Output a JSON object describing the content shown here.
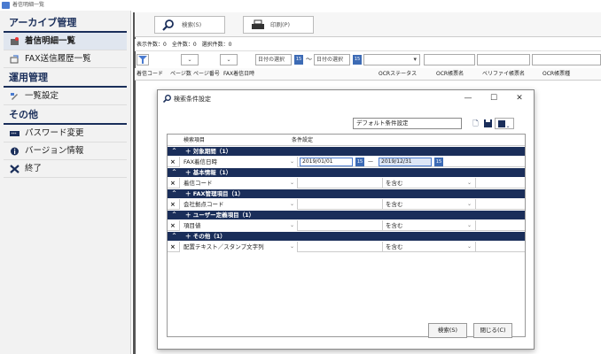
{
  "window": {
    "title": "着信明細一覧"
  },
  "sidebar": {
    "sections": [
      {
        "heading": "アーカイブ管理",
        "items": [
          {
            "label": "着信明細一覧",
            "icon": "fax-inbox-icon",
            "active": true
          },
          {
            "label": "FAX送信履歴一覧",
            "icon": "fax-sent-icon",
            "active": false
          }
        ]
      },
      {
        "heading": "運用管理",
        "items": [
          {
            "label": "一覧設定",
            "icon": "list-settings-icon",
            "active": false
          }
        ]
      },
      {
        "heading": "その他",
        "items": [
          {
            "label": "パスワード変更",
            "icon": "password-icon",
            "active": false
          },
          {
            "label": "バージョン情報",
            "icon": "info-icon",
            "active": false
          },
          {
            "label": "終了",
            "icon": "exit-icon",
            "active": false
          }
        ]
      }
    ]
  },
  "toolbar": {
    "search_label": "検索(S)",
    "print_label": "印刷(P)"
  },
  "counts": {
    "text": "表示件数：0　全件数：0　選択件数：0"
  },
  "filter": {
    "date_select_1": "日付の選択",
    "date_select_2": "日付の選択",
    "tilde": "～",
    "cal_label": "15"
  },
  "columns": [
    "着信コード",
    "ページ数",
    "ページ番号",
    "FAX着信日時",
    "OCRステータス",
    "OCR帳票名",
    "ベリファイ帳票名",
    "OCR帳票種"
  ],
  "dialog": {
    "title": "検索条件設定",
    "preset": "デフォルト条件設定",
    "header_field": "検索項目",
    "header_condition": "条件設定",
    "groups": [
      {
        "label": "対象期間（1）",
        "rows": [
          {
            "field": "FAX着信日時",
            "date_from": "2019/01/01",
            "date_to": "2019/12/31",
            "dash": "—"
          }
        ]
      },
      {
        "label": "基本情報（1）",
        "rows": [
          {
            "field": "着信コード",
            "condition": "を含む"
          }
        ]
      },
      {
        "label": "FAX管理項目（1）",
        "rows": [
          {
            "field": "会社拠点コード",
            "condition": "を含む"
          }
        ]
      },
      {
        "label": "ユーザー定義項目（1）",
        "rows": [
          {
            "field": "項目値",
            "condition": "を含む"
          }
        ]
      },
      {
        "label": "その他（1）",
        "rows": [
          {
            "field": "配置テキスト／スタンプ文字列",
            "condition": "を含む"
          }
        ]
      }
    ],
    "search_button": "検索(S)",
    "close_button": "閉じる(C)"
  },
  "colors": {
    "navy": "#1a2e5a",
    "accent": "#3d6bb5"
  }
}
